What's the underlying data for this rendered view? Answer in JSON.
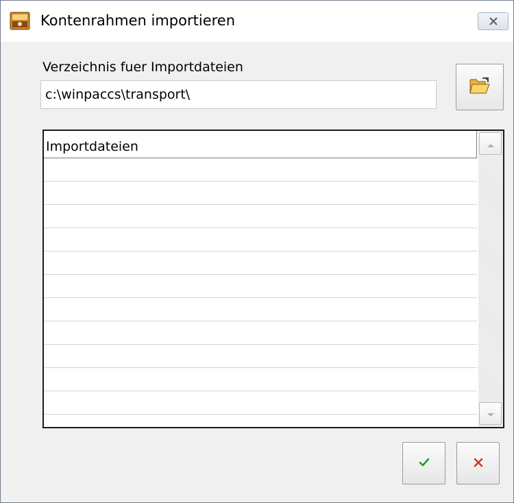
{
  "window": {
    "title": "Kontenrahmen importieren",
    "close_icon": "close-icon"
  },
  "directory": {
    "label": "Verzeichnis fuer Importdateien",
    "value": "c:\\winpaccs\\transport\\",
    "browse_icon": "folder-open-icon"
  },
  "file_list": {
    "column_header": "Importdateien",
    "rows": [
      "",
      "",
      "",
      "",
      "",
      "",
      "",
      "",
      "",
      "",
      "",
      ""
    ]
  },
  "buttons": {
    "ok_icon": "checkmark-icon",
    "ok_color": "#2a9a2a",
    "cancel_icon": "x-icon",
    "cancel_color": "#e03020"
  }
}
